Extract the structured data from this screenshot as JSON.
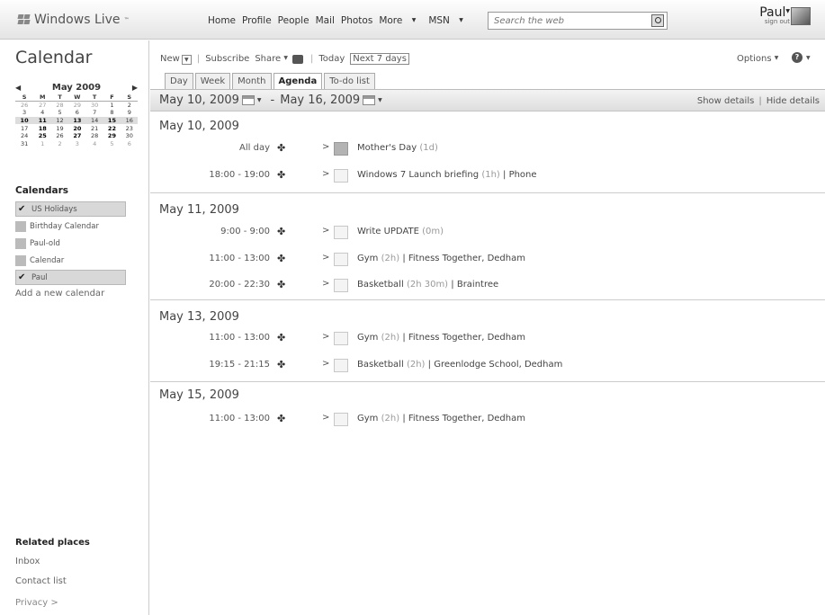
{
  "header": {
    "logo": "Windows Live",
    "nav": [
      {
        "label": "Home"
      },
      {
        "label": "Profile"
      },
      {
        "label": "People"
      },
      {
        "label": "Mail"
      },
      {
        "label": "Photos"
      },
      {
        "label": "More"
      },
      {
        "label": "MSN"
      }
    ],
    "search_placeholder": "Search the web",
    "user_name": "Paul",
    "sign_out": "sign out"
  },
  "sidebar": {
    "title": "Calendar",
    "mini_calendar": {
      "month": "May 2009",
      "weekdays": [
        "S",
        "M",
        "T",
        "W",
        "T",
        "F",
        "S"
      ],
      "weeks": [
        [
          "26",
          "27",
          "28",
          "29",
          "30",
          "1",
          "2"
        ],
        [
          "3",
          "4",
          "5",
          "6",
          "7",
          "8",
          "9"
        ],
        [
          "10",
          "11",
          "12",
          "13",
          "14",
          "15",
          "16"
        ],
        [
          "17",
          "18",
          "19",
          "20",
          "21",
          "22",
          "23"
        ],
        [
          "24",
          "25",
          "26",
          "27",
          "28",
          "29",
          "30"
        ],
        [
          "31",
          "1",
          "2",
          "3",
          "4",
          "5",
          "6"
        ]
      ]
    },
    "calendars_heading": "Calendars",
    "calendars": [
      {
        "label": "US Holidays",
        "checked": true
      },
      {
        "label": "Birthday Calendar",
        "checked": false
      },
      {
        "label": "Paul-old",
        "checked": false
      },
      {
        "label": "Calendar",
        "checked": false
      },
      {
        "label": "Paul",
        "checked": true
      }
    ],
    "add_calendar": "Add a new calendar",
    "related_heading": "Related places",
    "related": [
      "Inbox",
      "Contact list"
    ],
    "privacy": "Privacy >"
  },
  "toolbar": {
    "new": "New",
    "subscribe": "Subscribe",
    "share": "Share",
    "today": "Today",
    "next7": "Next 7 days",
    "options": "Options"
  },
  "tabs": [
    {
      "label": "Day",
      "active": false
    },
    {
      "label": "Week",
      "active": false
    },
    {
      "label": "Month",
      "active": false
    },
    {
      "label": "Agenda",
      "active": true
    },
    {
      "label": "To-do list",
      "active": false
    }
  ],
  "range": {
    "start": "May 10, 2009",
    "end": "May 16, 2009",
    "show_details": "Show details",
    "hide_details": "Hide details"
  },
  "agenda": [
    {
      "date": "May 10, 2009",
      "events": [
        {
          "time": "All day",
          "title": "Mother's Day",
          "duration": "(1d)",
          "extra": "",
          "dark": true
        },
        {
          "time": "18:00 - 19:00",
          "title": "Windows 7 Launch briefing",
          "duration": "(1h)",
          "extra": "| Phone",
          "dark": false
        }
      ]
    },
    {
      "date": "May 11, 2009",
      "events": [
        {
          "time": "9:00 - 9:00",
          "title": "Write UPDATE",
          "duration": "(0m)",
          "extra": "",
          "dark": false
        },
        {
          "time": "11:00 - 13:00",
          "title": "Gym",
          "duration": "(2h)",
          "extra": "| Fitness Together, Dedham",
          "dark": false
        },
        {
          "time": "20:00 - 22:30",
          "title": "Basketball",
          "duration": "(2h 30m)",
          "extra": "| Braintree",
          "dark": false
        }
      ]
    },
    {
      "date": "May 13, 2009",
      "events": [
        {
          "time": "11:00 - 13:00",
          "title": "Gym",
          "duration": "(2h)",
          "extra": "| Fitness Together, Dedham",
          "dark": false
        },
        {
          "time": "19:15 - 21:15",
          "title": "Basketball",
          "duration": "(2h)",
          "extra": "| Greenlodge School, Dedham",
          "dark": false
        }
      ]
    },
    {
      "date": "May 15, 2009",
      "events": [
        {
          "time": "11:00 - 13:00",
          "title": "Gym",
          "duration": "(2h)",
          "extra": "| Fitness Together, Dedham",
          "dark": false
        }
      ]
    }
  ]
}
